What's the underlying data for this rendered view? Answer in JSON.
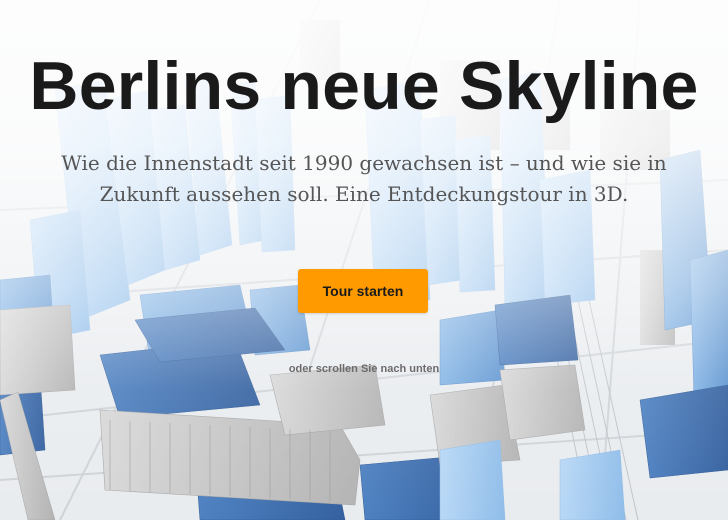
{
  "hero": {
    "title": "Berlins neue Skyline",
    "subtitle_line1": "Wie die Innenstadt seit 1990 gewachsen ist – und wie sie in",
    "subtitle_line2": "Zukunft aussehen soll. Eine Entdeckungstour in 3D.",
    "cta_label": "Tour starten",
    "scroll_hint": "oder scrollen Sie nach unten"
  },
  "colors": {
    "accent": "#ff9b00",
    "building_light": "#a9cdf2",
    "building_mid": "#6ea4dc",
    "building_dark": "#3f6fb0",
    "building_grey": "#c4c4c4"
  },
  "background": {
    "icon": "3d-city-map"
  }
}
